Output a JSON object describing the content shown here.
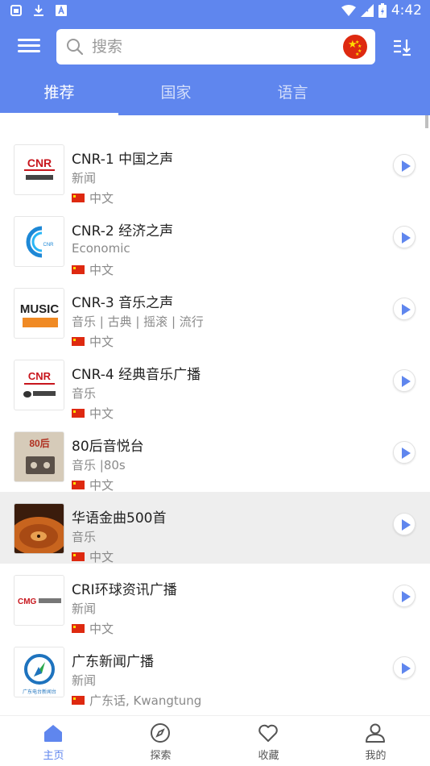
{
  "status_bar": {
    "time": "4:42"
  },
  "search": {
    "placeholder": "搜索"
  },
  "tabs": [
    {
      "label": "推荐"
    },
    {
      "label": "国家"
    },
    {
      "label": "语言"
    }
  ],
  "stations": [
    {
      "name": "CNR-1 中国之声",
      "genre": "新闻",
      "language": "中文",
      "logo_text": "CNR"
    },
    {
      "name": "CNR-2 经济之声",
      "genre": "Economic",
      "language": "中文",
      "logo_text": "CNR"
    },
    {
      "name": "CNR-3 音乐之声",
      "genre": "音乐 | 古典 | 摇滚 | 流行",
      "language": "中文",
      "logo_text": "MUSIC"
    },
    {
      "name": "CNR-4 经典音乐广播",
      "genre": "音乐",
      "language": "中文",
      "logo_text": "CNR"
    },
    {
      "name": "80后音悦台",
      "genre": "音乐 |80s",
      "language": "中文",
      "logo_text": "80后"
    },
    {
      "name": "华语金曲500首",
      "genre": "音乐",
      "language": "中文",
      "logo_text": ""
    },
    {
      "name": "CRI环球资讯广播",
      "genre": "新闻",
      "language": "中文",
      "logo_text": "CMG"
    },
    {
      "name": "广东新闻广播",
      "genre": "新闻",
      "language": "广东话, Kwangtung",
      "logo_text": "广东电台新闻台"
    }
  ],
  "bottom_nav": [
    {
      "label": "主页",
      "icon": "home-icon"
    },
    {
      "label": "探索",
      "icon": "compass-icon"
    },
    {
      "label": "收藏",
      "icon": "heart-icon"
    },
    {
      "label": "我的",
      "icon": "user-icon"
    }
  ],
  "colors": {
    "primary": "#5f86ee",
    "flag_red": "#de2910",
    "flag_yellow": "#ffde00"
  }
}
